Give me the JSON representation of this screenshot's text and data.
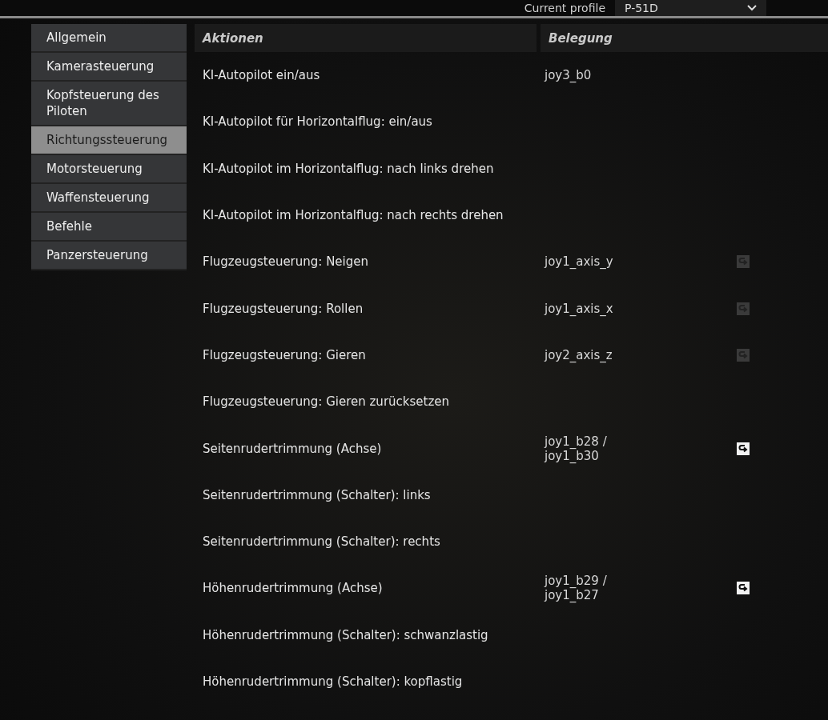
{
  "top_bar": {
    "profile_label": "Current profile",
    "profile_value": "P-51D"
  },
  "sidebar": {
    "items": [
      {
        "label": "Allgemein",
        "selected": false
      },
      {
        "label": "Kamerasteuerung",
        "selected": false
      },
      {
        "label": "Kopfsteuerung des Piloten",
        "selected": false
      },
      {
        "label": "Richtungssteuerung",
        "selected": true
      },
      {
        "label": "Motorsteuerung",
        "selected": false
      },
      {
        "label": "Waffensteuerung",
        "selected": false
      },
      {
        "label": "Befehle",
        "selected": false
      },
      {
        "label": "Panzersteuerung",
        "selected": false
      }
    ]
  },
  "table": {
    "columns": [
      "Aktionen",
      "Belegung"
    ],
    "rows": [
      {
        "action": "KI-Autopilot ein/aus",
        "binding": [
          "joy3_b0"
        ]
      },
      {
        "action": "KI-Autopilot für Horizontalflug: ein/aus",
        "binding": []
      },
      {
        "action": "KI-Autopilot im Horizontalflug: nach links drehen",
        "binding": []
      },
      {
        "action": "KI-Autopilot im Horizontalflug: nach rechts drehen",
        "binding": []
      },
      {
        "action": "Flugzeugsteuerung: Neigen",
        "binding": [
          "joy1_axis_y"
        ],
        "invert_on": false
      },
      {
        "action": "Flugzeugsteuerung: Rollen",
        "binding": [
          "joy1_axis_x"
        ],
        "invert_on": false
      },
      {
        "action": "Flugzeugsteuerung: Gieren",
        "binding": [
          "joy2_axis_z"
        ],
        "invert_on": false
      },
      {
        "action": "Flugzeugsteuerung: Gieren zurücksetzen",
        "binding": []
      },
      {
        "action": "Seitenrudertrimmung (Achse)",
        "binding": [
          "joy1_b28 /",
          "joy1_b30"
        ],
        "invert_on": true
      },
      {
        "action": "Seitenrudertrimmung (Schalter): links",
        "binding": []
      },
      {
        "action": "Seitenrudertrimmung (Schalter): rechts",
        "binding": []
      },
      {
        "action": "Höhenrudertrimmung (Achse)",
        "binding": [
          "joy1_b29 /",
          "joy1_b27"
        ],
        "invert_on": true
      },
      {
        "action": "Höhenrudertrimmung (Schalter): schwanzlastig",
        "binding": []
      },
      {
        "action": "Höhenrudertrimmung (Schalter): kopflastig",
        "binding": []
      }
    ]
  }
}
